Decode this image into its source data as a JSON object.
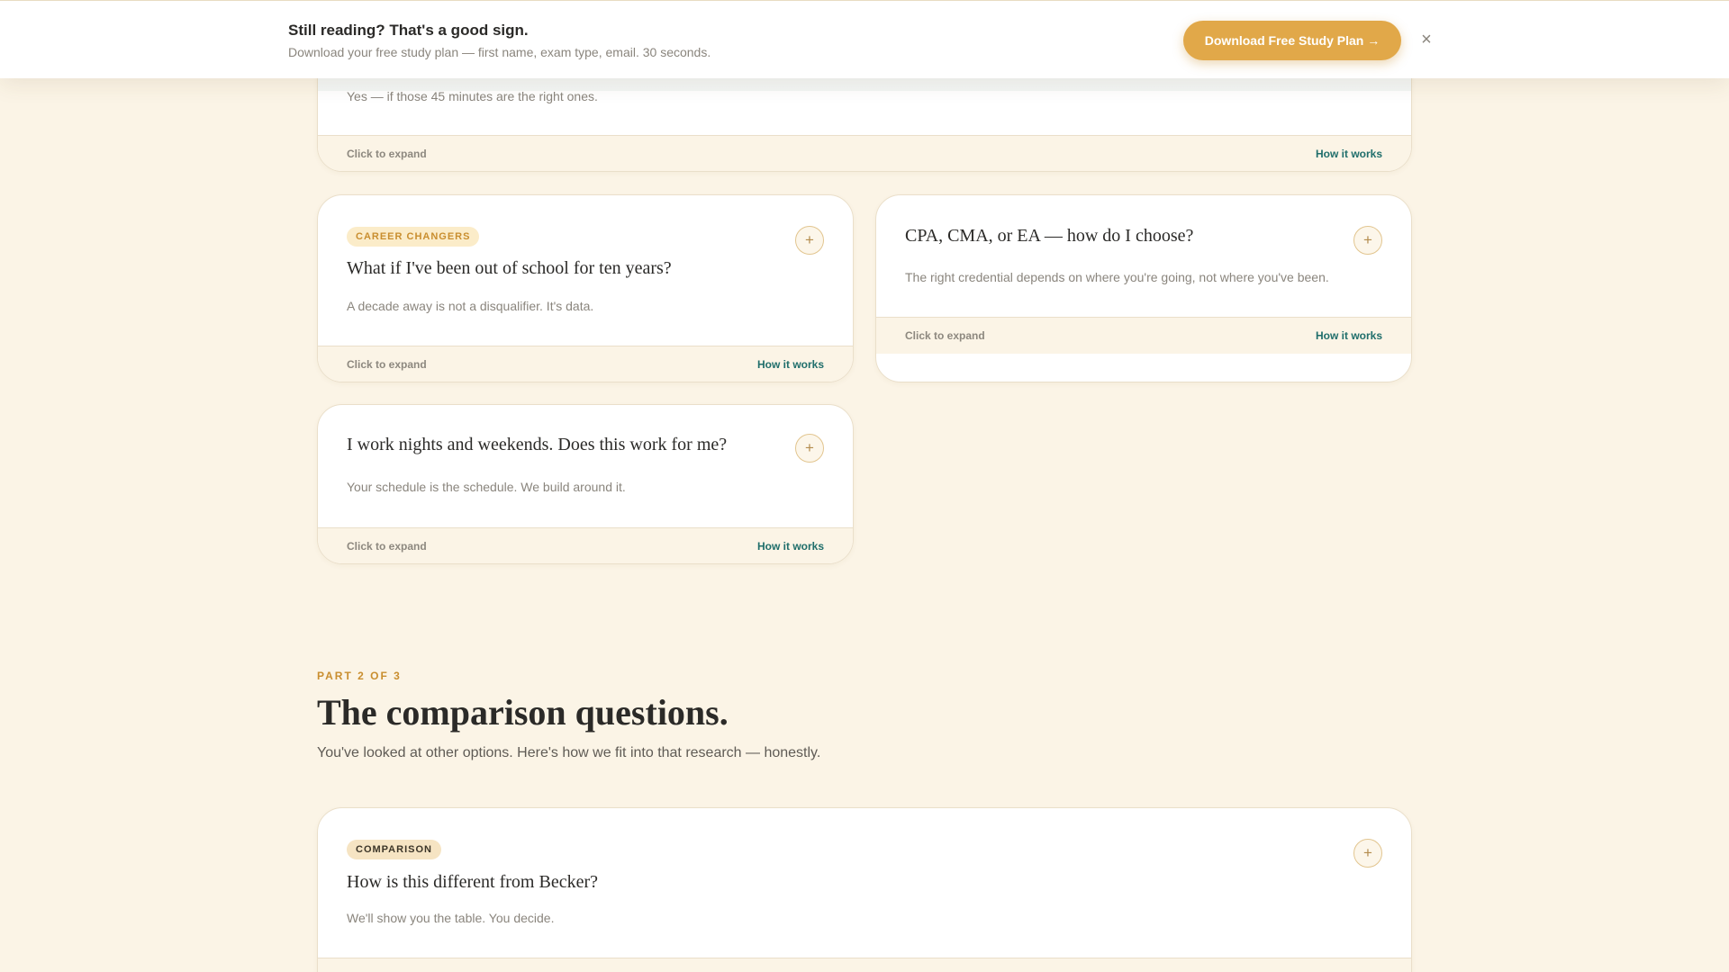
{
  "banner": {
    "title": "Still reading? That's a good sign.",
    "subtitle": "Download your free study plan — first name, exam type, email. 30 seconds.",
    "cta_label": "Download Free Study Plan →",
    "close_label": "×"
  },
  "card_footer": {
    "expand_label": "Click to expand",
    "how_label": "How it works"
  },
  "cards": {
    "top": {
      "answer": "Yes — if those 45 minutes are the right ones."
    },
    "career": {
      "badge": "CAREER CHANGERS",
      "question": "What if I've been out of school for ten years?",
      "answer": "A decade away is not a disqualifier. It's data."
    },
    "credential": {
      "question": "CPA, CMA, or EA — how do I choose?",
      "answer": "The right credential depends on where you're going, not where you've been."
    },
    "nights": {
      "question": "I work nights and weekends. Does this work for me?",
      "answer": "Your schedule is the schedule. We build around it."
    },
    "becker": {
      "badge": "COMPARISON",
      "question": "How is this different from Becker?",
      "answer": "We'll show you the table. You decide."
    }
  },
  "section": {
    "label": "PART 2 OF 3",
    "title": "The comparison questions.",
    "subtitle": "You've looked at other options. Here's how we fit into that research — honestly."
  },
  "icons": {
    "expand": "+",
    "close": "x-icon"
  },
  "colors": {
    "background": "#fbf4e6",
    "accent_gold": "#e1a849",
    "link_teal": "#1f6e6b"
  }
}
